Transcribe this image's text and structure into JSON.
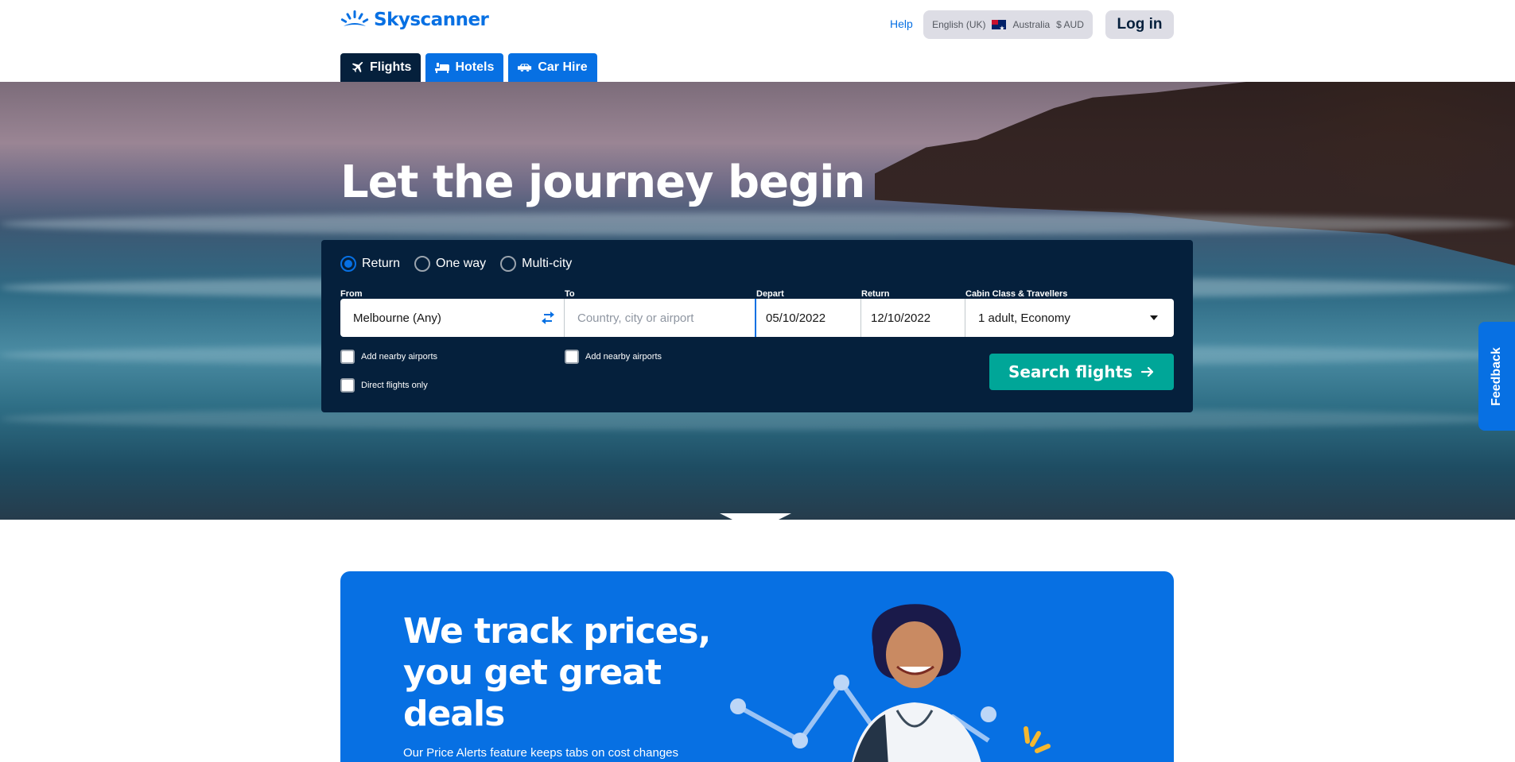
{
  "header": {
    "logo_text": "Skyscanner",
    "help": "Help",
    "locale": {
      "language": "English (UK)",
      "country": "Australia",
      "currency": "$ AUD"
    },
    "login": "Log in"
  },
  "tabs": [
    {
      "label": "Flights",
      "icon": "plane-icon",
      "active": true
    },
    {
      "label": "Hotels",
      "icon": "bed-icon",
      "active": false
    },
    {
      "label": "Car Hire",
      "icon": "car-icon",
      "active": false
    }
  ],
  "hero": {
    "title": "Let the journey begin"
  },
  "search": {
    "trip_types": [
      "Return",
      "One way",
      "Multi-city"
    ],
    "selected_trip_type": "Return",
    "labels": {
      "from": "From",
      "to": "To",
      "depart": "Depart",
      "return": "Return",
      "cabin": "Cabin Class & Travellers"
    },
    "from_value": "Melbourne (Any)",
    "to_placeholder": "Country, city or airport",
    "depart_value": "05/10/2022",
    "return_value": "12/10/2022",
    "cabin_value": "1 adult, Economy",
    "nearby_from": "Add nearby airports",
    "nearby_to": "Add nearby airports",
    "direct_only": "Direct flights only",
    "button": "Search flights"
  },
  "feedback": "Feedback",
  "promo": {
    "title": "We track prices, you get great deals",
    "subtitle": "Our Price Alerts feature keeps tabs on cost changes"
  },
  "colors": {
    "brand_blue": "#0770e3",
    "navy": "#05203c",
    "teal": "#00a698"
  }
}
